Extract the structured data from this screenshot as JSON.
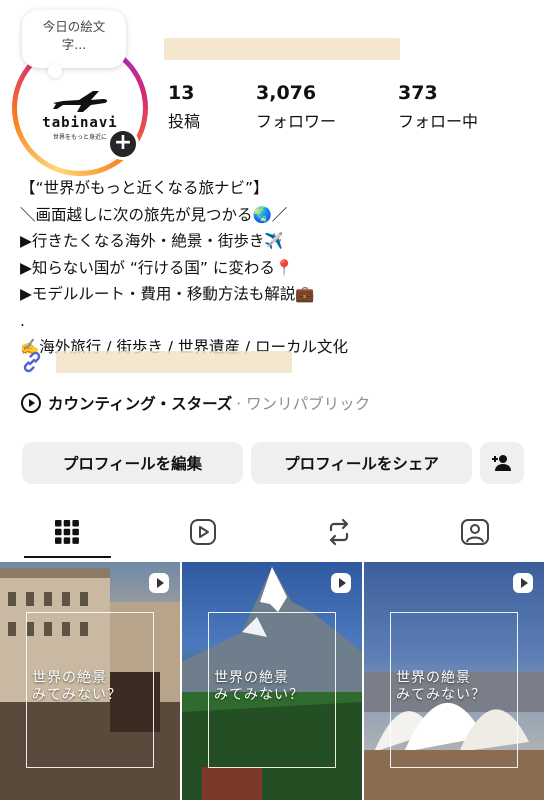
{
  "note": {
    "text_line1": "今日の絵文",
    "text_line2": "字..."
  },
  "profile": {
    "logo_name": "tabinavi",
    "logo_tagline": "世界をもっと身近に"
  },
  "stats": {
    "posts_count": "13",
    "posts_label": "投稿",
    "followers_count": "3,076",
    "followers_label": "フォロワー",
    "following_count": "373",
    "following_label": "フォロー中"
  },
  "bio": {
    "lines": [
      "【“世界がもっと近くなる旅ナビ”】",
      "＼画面越しに次の旅先が見つかる🌏／",
      "▶︎行きたくなる海外・絶景・街歩き✈️",
      "▶︎知らない国が “行ける国” に変わる📍",
      "▶︎モデルルート・費用・移動方法も解説💼",
      ".",
      "✍️海外旅行 / 街歩き / 世界遺産 / ローカル文化"
    ]
  },
  "music": {
    "title": "カウンティング・スターズ",
    "artist": "· ワンリパブリック"
  },
  "buttons": {
    "edit_profile": "プロフィールを編集",
    "share_profile": "プロフィールをシェア"
  },
  "tabs": [
    "grid-icon",
    "reels-icon",
    "reposts-icon",
    "tagged-icon"
  ],
  "posts": [
    {
      "title_line1": "世界の絶景",
      "title_line2": "みてみない？"
    },
    {
      "title_line1": "世界の絶景",
      "title_line2": "みてみない？"
    },
    {
      "title_line1": "世界の絶景",
      "title_line2": "みてみない？"
    }
  ],
  "colors": {
    "button_bg": "#efefef",
    "link_icon": "#4f63d2",
    "story_ring": "#d62976"
  }
}
